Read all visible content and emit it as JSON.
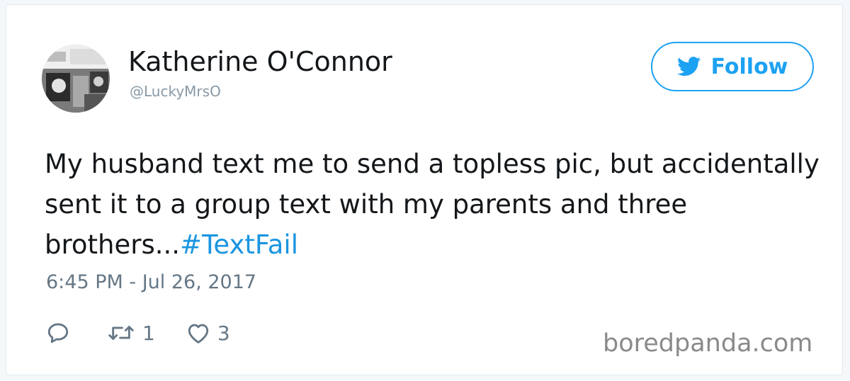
{
  "author": {
    "name": "Katherine O'Connor",
    "handle": "@LuckyMrsO",
    "avatar_icon": "avatar-photo"
  },
  "follow_button": {
    "label": "Follow",
    "icon": "twitter-bird-icon",
    "color": "#1da1f2"
  },
  "tweet": {
    "text": "My husband text me to send a topless pic, but accidentally sent it to a group text with my parents and three brothers...",
    "hashtag": "#TextFail",
    "hashtag_color": "#1b95e0",
    "timestamp": "6:45 PM - Jul 26, 2017"
  },
  "actions": {
    "reply": {
      "icon": "reply-icon",
      "count": ""
    },
    "retweet": {
      "icon": "retweet-icon",
      "count": "1"
    },
    "like": {
      "icon": "heart-icon",
      "count": "3"
    }
  },
  "watermark": "boredpanda.com"
}
